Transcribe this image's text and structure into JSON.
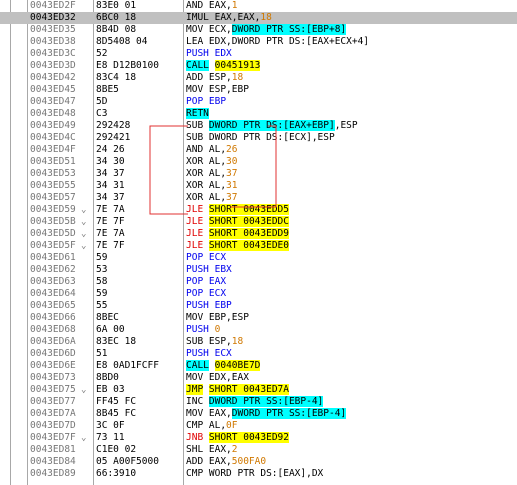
{
  "rows": [
    {
      "addr": "0043ED2F",
      "arrow": "",
      "hex": "83E0 01",
      "dis": [
        {
          "t": "AND EAX,"
        },
        {
          "t": "1",
          "c": "orange"
        }
      ]
    },
    {
      "addr": "0043ED32",
      "arrow": "",
      "hex": "6BC0 18",
      "dis": [
        {
          "t": "IMUL EAX,EAX,"
        },
        {
          "t": "18",
          "c": "orange"
        }
      ],
      "sel": true
    },
    {
      "addr": "0043ED35",
      "arrow": "",
      "hex": "8B4D 08",
      "dis": [
        {
          "t": "MOV ECX,"
        },
        {
          "t": "DWORD PTR SS:[EBP+8]",
          "c": "cyan"
        }
      ]
    },
    {
      "addr": "0043ED38",
      "arrow": "",
      "hex": "8D5408 04",
      "dis": [
        {
          "t": "LEA EDX,DWORD PTR DS:[EAX+ECX+4]"
        }
      ]
    },
    {
      "addr": "0043ED3C",
      "arrow": "",
      "hex": "52",
      "dis": [
        {
          "t": "PUSH EDX",
          "c": "blue"
        }
      ]
    },
    {
      "addr": "0043ED3D",
      "arrow": "",
      "hex": "E8 D12B0100",
      "dis": [
        {
          "t": "CALL",
          "c": "cyan"
        },
        {
          "t": " "
        },
        {
          "t": "00451913",
          "c": "yellow"
        }
      ]
    },
    {
      "addr": "0043ED42",
      "arrow": "",
      "hex": "83C4 18",
      "dis": [
        {
          "t": "ADD ESP,"
        },
        {
          "t": "18",
          "c": "orange"
        }
      ]
    },
    {
      "addr": "0043ED45",
      "arrow": "",
      "hex": "8BE5",
      "dis": [
        {
          "t": "MOV ESP,EBP"
        }
      ]
    },
    {
      "addr": "0043ED47",
      "arrow": "",
      "hex": "5D",
      "dis": [
        {
          "t": "POP EBP",
          "c": "blue"
        }
      ]
    },
    {
      "addr": "0043ED48",
      "arrow": "",
      "hex": "C3",
      "dis": [
        {
          "t": "RETN",
          "c": "cyan"
        }
      ]
    },
    {
      "addr": "0043ED49",
      "arrow": "",
      "hex": "292428",
      "dis": [
        {
          "t": "SUB "
        },
        {
          "t": "DWORD PTR DS:[EAX+EBP]",
          "c": "cyan"
        },
        {
          "t": ",ESP"
        }
      ]
    },
    {
      "addr": "0043ED4C",
      "arrow": "",
      "hex": "292421",
      "dis": [
        {
          "t": "SUB DWORD PTR DS:[ECX],ESP"
        }
      ]
    },
    {
      "addr": "0043ED4F",
      "arrow": "",
      "hex": "24 26",
      "dis": [
        {
          "t": "AND AL,"
        },
        {
          "t": "26",
          "c": "orange"
        }
      ]
    },
    {
      "addr": "0043ED51",
      "arrow": "",
      "hex": "34 30",
      "dis": [
        {
          "t": "XOR AL,"
        },
        {
          "t": "30",
          "c": "orange"
        }
      ]
    },
    {
      "addr": "0043ED53",
      "arrow": "",
      "hex": "34 37",
      "dis": [
        {
          "t": "XOR AL,"
        },
        {
          "t": "37",
          "c": "orange"
        }
      ]
    },
    {
      "addr": "0043ED55",
      "arrow": "",
      "hex": "34 31",
      "dis": [
        {
          "t": "XOR AL,"
        },
        {
          "t": "31",
          "c": "orange"
        }
      ]
    },
    {
      "addr": "0043ED57",
      "arrow": "",
      "hex": "34 37",
      "dis": [
        {
          "t": "XOR AL,"
        },
        {
          "t": "37",
          "c": "orange"
        }
      ]
    },
    {
      "addr": "0043ED59",
      "arrow": "⌄",
      "hex": "7E 7A",
      "dis": [
        {
          "t": "JLE",
          "c": "red"
        },
        {
          "t": " "
        },
        {
          "t": "SHORT 0043EDD5",
          "c": "yellow"
        }
      ]
    },
    {
      "addr": "0043ED5B",
      "arrow": "⌄",
      "hex": "7E 7F",
      "dis": [
        {
          "t": "JLE",
          "c": "red"
        },
        {
          "t": " "
        },
        {
          "t": "SHORT 0043EDDC",
          "c": "yellow"
        }
      ]
    },
    {
      "addr": "0043ED5D",
      "arrow": "⌄",
      "hex": "7E 7A",
      "dis": [
        {
          "t": "JLE",
          "c": "red"
        },
        {
          "t": " "
        },
        {
          "t": "SHORT 0043EDD9",
          "c": "yellow"
        }
      ]
    },
    {
      "addr": "0043ED5F",
      "arrow": "⌄",
      "hex": "7E 7F",
      "dis": [
        {
          "t": "JLE",
          "c": "red"
        },
        {
          "t": " "
        },
        {
          "t": "SHORT 0043EDE0",
          "c": "yellow"
        }
      ]
    },
    {
      "addr": "0043ED61",
      "arrow": "",
      "hex": "59",
      "dis": [
        {
          "t": "POP ECX",
          "c": "blue"
        }
      ]
    },
    {
      "addr": "0043ED62",
      "arrow": "",
      "hex": "53",
      "dis": [
        {
          "t": "PUSH EBX",
          "c": "blue"
        }
      ]
    },
    {
      "addr": "0043ED63",
      "arrow": "",
      "hex": "58",
      "dis": [
        {
          "t": "POP EAX",
          "c": "blue"
        }
      ]
    },
    {
      "addr": "0043ED64",
      "arrow": "",
      "hex": "59",
      "dis": [
        {
          "t": "POP ECX",
          "c": "blue"
        }
      ]
    },
    {
      "addr": "0043ED65",
      "arrow": "",
      "hex": "55",
      "dis": [
        {
          "t": "PUSH EBP",
          "c": "blue"
        }
      ]
    },
    {
      "addr": "0043ED66",
      "arrow": "",
      "hex": "8BEC",
      "dis": [
        {
          "t": "MOV EBP,ESP"
        }
      ]
    },
    {
      "addr": "0043ED68",
      "arrow": "",
      "hex": "6A 00",
      "dis": [
        {
          "t": "PUSH ",
          "c": "blue"
        },
        {
          "t": "0",
          "c": "orange"
        }
      ]
    },
    {
      "addr": "0043ED6A",
      "arrow": "",
      "hex": "83EC 18",
      "dis": [
        {
          "t": "SUB ESP,"
        },
        {
          "t": "18",
          "c": "orange"
        }
      ]
    },
    {
      "addr": "0043ED6D",
      "arrow": "",
      "hex": "51",
      "dis": [
        {
          "t": "PUSH ECX",
          "c": "blue"
        }
      ]
    },
    {
      "addr": "0043ED6E",
      "arrow": "",
      "hex": "E8 0AD1FCFF",
      "dis": [
        {
          "t": "CALL",
          "c": "cyan"
        },
        {
          "t": " "
        },
        {
          "t": "0040BE7D",
          "c": "yellow"
        }
      ]
    },
    {
      "addr": "0043ED73",
      "arrow": "",
      "hex": "8BD0",
      "dis": [
        {
          "t": "MOV EDX,EAX"
        }
      ]
    },
    {
      "addr": "0043ED75",
      "arrow": "⌄",
      "hex": "EB 03",
      "dis": [
        {
          "t": "JMP",
          "c": "yellow"
        },
        {
          "t": " "
        },
        {
          "t": "SHORT 0043ED7A",
          "c": "yellow"
        }
      ]
    },
    {
      "addr": "0043ED77",
      "arrow": "",
      "hex": "FF45 FC",
      "dis": [
        {
          "t": "INC "
        },
        {
          "t": "DWORD PTR SS:[EBP-4]",
          "c": "cyan"
        }
      ]
    },
    {
      "addr": "0043ED7A",
      "arrow": "",
      "hex": "8B45 FC",
      "dis": [
        {
          "t": "MOV EAX,"
        },
        {
          "t": "DWORD PTR SS:[EBP-4]",
          "c": "cyan"
        }
      ]
    },
    {
      "addr": "0043ED7D",
      "arrow": "",
      "hex": "3C 0F",
      "dis": [
        {
          "t": "CMP AL,"
        },
        {
          "t": "0F",
          "c": "orange"
        }
      ]
    },
    {
      "addr": "0043ED7F",
      "arrow": "⌄",
      "hex": "73 11",
      "dis": [
        {
          "t": "JNB",
          "c": "red"
        },
        {
          "t": " "
        },
        {
          "t": "SHORT 0043ED92",
          "c": "yellow"
        }
      ]
    },
    {
      "addr": "0043ED81",
      "arrow": "",
      "hex": "C1E0 02",
      "dis": [
        {
          "t": "SHL EAX,"
        },
        {
          "t": "2",
          "c": "orange"
        }
      ]
    },
    {
      "addr": "0043ED84",
      "arrow": "",
      "hex": "05 A00F5000",
      "dis": [
        {
          "t": "ADD EAX,"
        },
        {
          "t": "500FA0",
          "c": "orange"
        }
      ]
    },
    {
      "addr": "0043ED89",
      "arrow": "",
      "hex": "66:3910",
      "dis": [
        {
          "t": "CMP WORD PTR DS:[EAX],DX"
        }
      ]
    }
  ],
  "colors": {
    "row_selected_bg": "#c0c0c0",
    "jump_line": "#e03030",
    "address_text": "#777777",
    "immediate": "#d07800",
    "stack_op": "#0000ee",
    "mem_highlight": "#00ffff",
    "branch_highlight": "#ffff00",
    "cond_jump_text": "#e00000"
  },
  "icons": {
    "jump_marker": "chevron-down-icon",
    "jump_arrow": "branch-arrow-icon"
  }
}
